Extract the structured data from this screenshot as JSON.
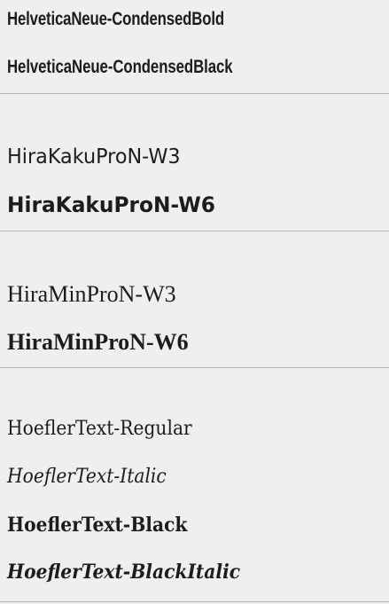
{
  "font_groups": [
    {
      "items": [
        "HelveticaNeue-CondensedBold",
        "HelveticaNeue-CondensedBlack"
      ]
    },
    {
      "items": [
        "HiraKakuProN-W3",
        "HiraKakuProN-W6"
      ]
    },
    {
      "items": [
        "HiraMinProN-W3",
        "HiraMinProN-W6"
      ]
    },
    {
      "items": [
        "HoeflerText-Regular",
        "HoeflerText-Italic",
        "HoeflerText-Black",
        "HoeflerText-BlackItalic"
      ]
    }
  ],
  "colors": {
    "background": "#efeff0",
    "text": "#1c1c1c",
    "divider": "#b9b9bb"
  }
}
